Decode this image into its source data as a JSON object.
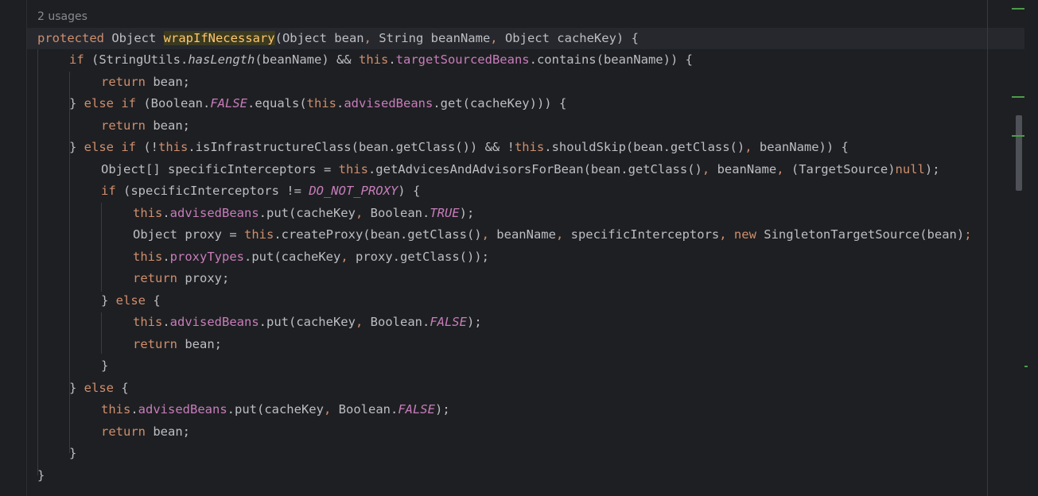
{
  "usages_hint": "2 usages",
  "code": {
    "l1": {
      "a": "protected",
      "b": " Object ",
      "c": "wrapIfNecessary",
      "d": "(Object bean",
      "e": ", ",
      "f": "String beanName",
      "g": ", ",
      "h": "Object cacheKey) {"
    },
    "l2": {
      "a": "if",
      "b": " (StringUtils.",
      "c": "hasLength",
      "d": "(beanName) && ",
      "e": "this",
      "f": ".",
      "g": "targetSourcedBeans",
      "h": ".contains(beanName)) {"
    },
    "l3": {
      "a": "return",
      "b": " bean;"
    },
    "l4": {
      "a": "} ",
      "b": "else if",
      "c": " (Boolean.",
      "d": "FALSE",
      "e": ".equals(",
      "f": "this",
      "g": ".",
      "h": "advisedBeans",
      "i": ".get(cacheKey))) {"
    },
    "l5": {
      "a": "return",
      "b": " bean;"
    },
    "l6": {
      "a": "} ",
      "b": "else if",
      "c": " (!",
      "d": "this",
      "e": ".isInfrastructureClass(bean.getClass()) && !",
      "f": "this",
      "g": ".shouldSkip(bean.getClass()",
      "h": ", ",
      "i": "beanName)) {"
    },
    "l7": {
      "a": "Object[] specificInterceptors = ",
      "b": "this",
      "c": ".getAdvicesAndAdvisorsForBean(bean.getClass()",
      "d": ", ",
      "e": "beanName",
      "f": ", ",
      "g": "(TargetSource)",
      "h": "null",
      "i": ");"
    },
    "l8": {
      "a": "if",
      "b": " (specificInterceptors != ",
      "c": "DO_NOT_PROXY",
      "d": ") {"
    },
    "l9": {
      "a": "this",
      "b": ".",
      "c": "advisedBeans",
      "d": ".put(cacheKey",
      "e": ", ",
      "f": "Boolean.",
      "g": "TRUE",
      "h": ");"
    },
    "l10": {
      "a": "Object proxy = ",
      "b": "this",
      "c": ".createProxy(bean.getClass()",
      "d": ", ",
      "e": "beanName",
      "f": ", ",
      "g": "specificInterceptors",
      "h": ", ",
      "i": "new",
      "j": " SingletonTargetSource(bean)",
      "k": ";"
    },
    "l11": {
      "a": "this",
      "b": ".",
      "c": "proxyTypes",
      "d": ".put(cacheKey",
      "e": ", ",
      "f": "proxy.getClass());"
    },
    "l12": {
      "a": "return",
      "b": " proxy;"
    },
    "l13": {
      "a": "} ",
      "b": "else",
      "c": " {"
    },
    "l14": {
      "a": "this",
      "b": ".",
      "c": "advisedBeans",
      "d": ".put(cacheKey",
      "e": ", ",
      "f": "Boolean.",
      "g": "FALSE",
      "h": ");"
    },
    "l15": {
      "a": "return",
      "b": " bean;"
    },
    "l16": {
      "a": "}"
    },
    "l17": {
      "a": "} ",
      "b": "else",
      "c": " {"
    },
    "l18": {
      "a": "this",
      "b": ".",
      "c": "advisedBeans",
      "d": ".put(cacheKey",
      "e": ", ",
      "f": "Boolean.",
      "g": "FALSE",
      "h": ");"
    },
    "l19": {
      "a": "return",
      "b": " bean;"
    },
    "l20": {
      "a": "}"
    },
    "l21": {
      "a": "}"
    }
  },
  "colors": {
    "background": "#1e1f22",
    "keyword": "#cf8e6d",
    "field": "#c77dbb",
    "text": "#bcbec4",
    "hint": "#868a91"
  }
}
